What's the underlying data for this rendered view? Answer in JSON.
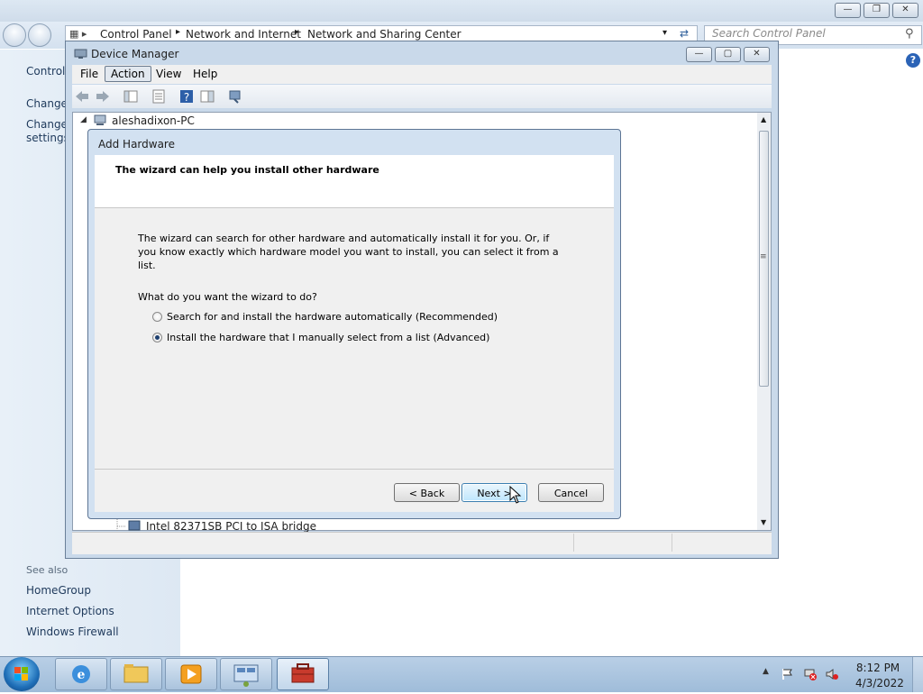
{
  "control_panel": {
    "breadcrumb": [
      "Control Panel",
      "Network and Internet",
      "Network and Sharing Center"
    ],
    "search_placeholder": "Search Control Panel",
    "left_links_top": [
      "Control",
      "Change",
      "Change",
      "settings"
    ],
    "see_also_label": "See also",
    "see_also_links": [
      "HomeGroup",
      "Internet Options",
      "Windows Firewall"
    ]
  },
  "device_manager": {
    "title": "Device Manager",
    "menu": [
      "File",
      "Action",
      "View",
      "Help"
    ],
    "tree_root": "aleshadixon-PC",
    "tree_last_visible": "Intel 82371SB PCI to ISA bridge"
  },
  "wizard": {
    "title": "Add Hardware",
    "heading": "The wizard can help you install other hardware",
    "description": "The wizard can search for other hardware and automatically install it for you. Or, if you know exactly which hardware model you want to install, you can select it from a list.",
    "question": "What do you want the wizard to do?",
    "options": [
      {
        "label": "Search for and install the hardware automatically (Recommended)",
        "selected": false
      },
      {
        "label": "Install the hardware that I manually select from a list (Advanced)",
        "selected": true
      }
    ],
    "back_label": "< Back",
    "next_label": "Next >",
    "cancel_label": "Cancel"
  },
  "taskbar": {
    "time": "8:12 PM",
    "date": "4/3/2022",
    "apps": [
      "internet-explorer-icon",
      "explorer-folder-icon",
      "media-player-icon",
      "control-panel-icon",
      "device-manager-toolbox-icon"
    ]
  },
  "colors": {
    "accent": "#3c7fb1",
    "window_frame": "#c9d9ea",
    "taskbar": "#a9c3de"
  }
}
